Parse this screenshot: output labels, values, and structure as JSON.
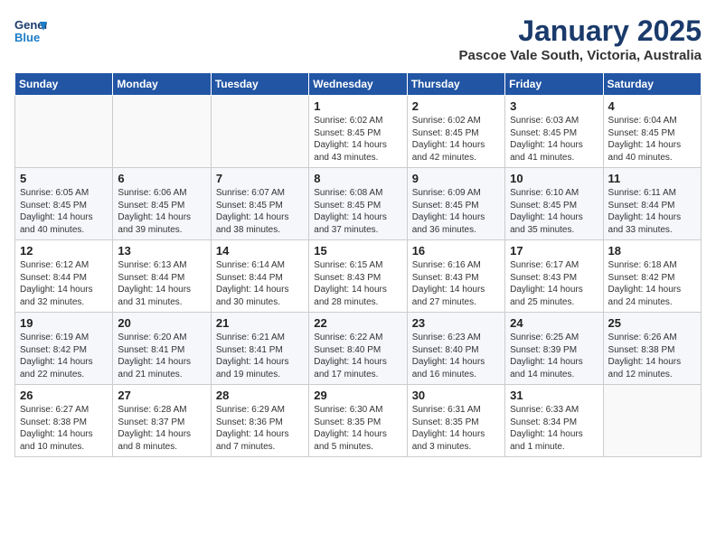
{
  "header": {
    "logo_line1": "General",
    "logo_line2": "Blue",
    "month_title": "January 2025",
    "location": "Pascoe Vale South, Victoria, Australia"
  },
  "weekdays": [
    "Sunday",
    "Monday",
    "Tuesday",
    "Wednesday",
    "Thursday",
    "Friday",
    "Saturday"
  ],
  "weeks": [
    [
      {
        "day": "",
        "info": ""
      },
      {
        "day": "",
        "info": ""
      },
      {
        "day": "",
        "info": ""
      },
      {
        "day": "1",
        "info": "Sunrise: 6:02 AM\nSunset: 8:45 PM\nDaylight: 14 hours\nand 43 minutes."
      },
      {
        "day": "2",
        "info": "Sunrise: 6:02 AM\nSunset: 8:45 PM\nDaylight: 14 hours\nand 42 minutes."
      },
      {
        "day": "3",
        "info": "Sunrise: 6:03 AM\nSunset: 8:45 PM\nDaylight: 14 hours\nand 41 minutes."
      },
      {
        "day": "4",
        "info": "Sunrise: 6:04 AM\nSunset: 8:45 PM\nDaylight: 14 hours\nand 40 minutes."
      }
    ],
    [
      {
        "day": "5",
        "info": "Sunrise: 6:05 AM\nSunset: 8:45 PM\nDaylight: 14 hours\nand 40 minutes."
      },
      {
        "day": "6",
        "info": "Sunrise: 6:06 AM\nSunset: 8:45 PM\nDaylight: 14 hours\nand 39 minutes."
      },
      {
        "day": "7",
        "info": "Sunrise: 6:07 AM\nSunset: 8:45 PM\nDaylight: 14 hours\nand 38 minutes."
      },
      {
        "day": "8",
        "info": "Sunrise: 6:08 AM\nSunset: 8:45 PM\nDaylight: 14 hours\nand 37 minutes."
      },
      {
        "day": "9",
        "info": "Sunrise: 6:09 AM\nSunset: 8:45 PM\nDaylight: 14 hours\nand 36 minutes."
      },
      {
        "day": "10",
        "info": "Sunrise: 6:10 AM\nSunset: 8:45 PM\nDaylight: 14 hours\nand 35 minutes."
      },
      {
        "day": "11",
        "info": "Sunrise: 6:11 AM\nSunset: 8:44 PM\nDaylight: 14 hours\nand 33 minutes."
      }
    ],
    [
      {
        "day": "12",
        "info": "Sunrise: 6:12 AM\nSunset: 8:44 PM\nDaylight: 14 hours\nand 32 minutes."
      },
      {
        "day": "13",
        "info": "Sunrise: 6:13 AM\nSunset: 8:44 PM\nDaylight: 14 hours\nand 31 minutes."
      },
      {
        "day": "14",
        "info": "Sunrise: 6:14 AM\nSunset: 8:44 PM\nDaylight: 14 hours\nand 30 minutes."
      },
      {
        "day": "15",
        "info": "Sunrise: 6:15 AM\nSunset: 8:43 PM\nDaylight: 14 hours\nand 28 minutes."
      },
      {
        "day": "16",
        "info": "Sunrise: 6:16 AM\nSunset: 8:43 PM\nDaylight: 14 hours\nand 27 minutes."
      },
      {
        "day": "17",
        "info": "Sunrise: 6:17 AM\nSunset: 8:43 PM\nDaylight: 14 hours\nand 25 minutes."
      },
      {
        "day": "18",
        "info": "Sunrise: 6:18 AM\nSunset: 8:42 PM\nDaylight: 14 hours\nand 24 minutes."
      }
    ],
    [
      {
        "day": "19",
        "info": "Sunrise: 6:19 AM\nSunset: 8:42 PM\nDaylight: 14 hours\nand 22 minutes."
      },
      {
        "day": "20",
        "info": "Sunrise: 6:20 AM\nSunset: 8:41 PM\nDaylight: 14 hours\nand 21 minutes."
      },
      {
        "day": "21",
        "info": "Sunrise: 6:21 AM\nSunset: 8:41 PM\nDaylight: 14 hours\nand 19 minutes."
      },
      {
        "day": "22",
        "info": "Sunrise: 6:22 AM\nSunset: 8:40 PM\nDaylight: 14 hours\nand 17 minutes."
      },
      {
        "day": "23",
        "info": "Sunrise: 6:23 AM\nSunset: 8:40 PM\nDaylight: 14 hours\nand 16 minutes."
      },
      {
        "day": "24",
        "info": "Sunrise: 6:25 AM\nSunset: 8:39 PM\nDaylight: 14 hours\nand 14 minutes."
      },
      {
        "day": "25",
        "info": "Sunrise: 6:26 AM\nSunset: 8:38 PM\nDaylight: 14 hours\nand 12 minutes."
      }
    ],
    [
      {
        "day": "26",
        "info": "Sunrise: 6:27 AM\nSunset: 8:38 PM\nDaylight: 14 hours\nand 10 minutes."
      },
      {
        "day": "27",
        "info": "Sunrise: 6:28 AM\nSunset: 8:37 PM\nDaylight: 14 hours\nand 8 minutes."
      },
      {
        "day": "28",
        "info": "Sunrise: 6:29 AM\nSunset: 8:36 PM\nDaylight: 14 hours\nand 7 minutes."
      },
      {
        "day": "29",
        "info": "Sunrise: 6:30 AM\nSunset: 8:35 PM\nDaylight: 14 hours\nand 5 minutes."
      },
      {
        "day": "30",
        "info": "Sunrise: 6:31 AM\nSunset: 8:35 PM\nDaylight: 14 hours\nand 3 minutes."
      },
      {
        "day": "31",
        "info": "Sunrise: 6:33 AM\nSunset: 8:34 PM\nDaylight: 14 hours\nand 1 minute."
      },
      {
        "day": "",
        "info": ""
      }
    ]
  ]
}
